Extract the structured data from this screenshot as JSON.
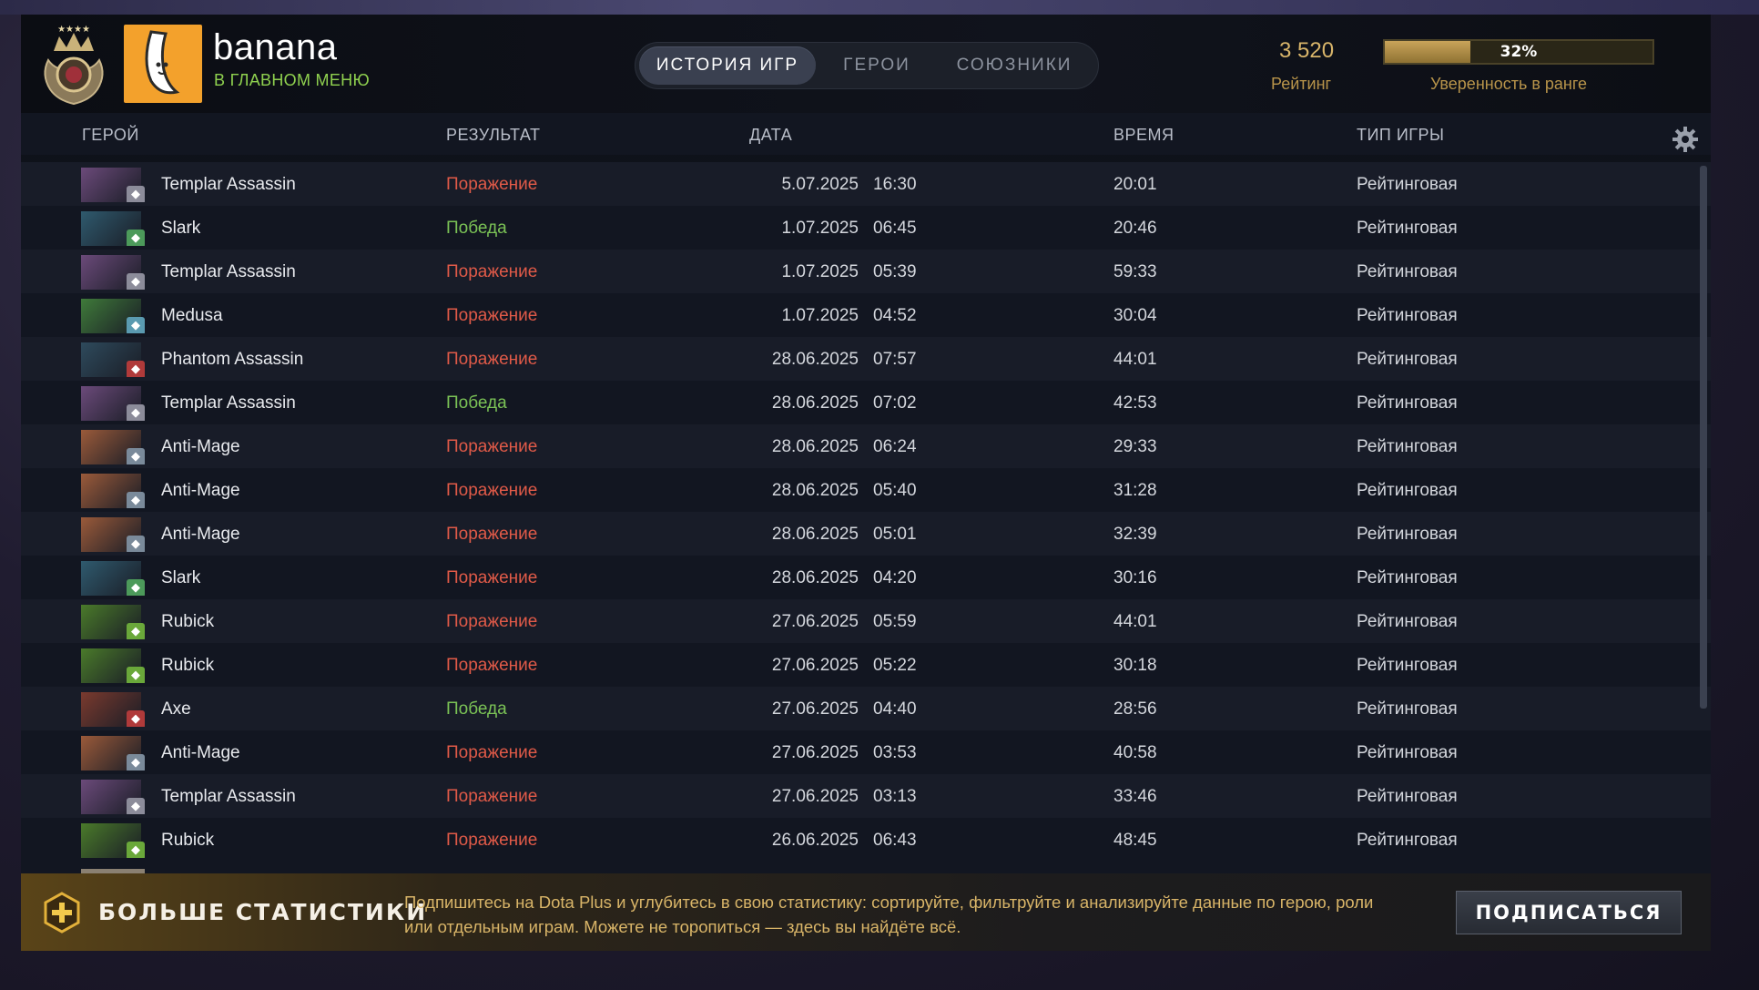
{
  "profile": {
    "name": "banana",
    "status": "В ГЛАВНОМ МЕНЮ",
    "rank_medal_icon": "rank-medal-icon",
    "avatar_icon": "banana-avatar-icon"
  },
  "tabs": [
    {
      "label": "ИСТОРИЯ ИГР",
      "active": true
    },
    {
      "label": "ГЕРОИ",
      "active": false
    },
    {
      "label": "СОЮЗНИКИ",
      "active": false
    }
  ],
  "rating": {
    "value": "3 520",
    "label": "Рейтинг"
  },
  "confidence": {
    "percent_text": "32%",
    "fraction": 0.32,
    "label": "Уверенность в ранге"
  },
  "columns": {
    "hero": "ГЕРОЙ",
    "result": "РЕЗУЛЬТАТ",
    "date": "ДАТА",
    "duration": "ВРЕМЯ",
    "game_type": "ТИП ИГРЫ"
  },
  "matches": [
    {
      "hero": "Templar Assassin",
      "result": "Поражение",
      "win": false,
      "date": "5.07.2025",
      "time": "16:30",
      "duration": "20:01",
      "type": "Рейтинговая",
      "portrait": "#6b4a7a",
      "badge": "#8c8c9a"
    },
    {
      "hero": "Slark",
      "result": "Победа",
      "win": true,
      "date": "1.07.2025",
      "time": "06:45",
      "duration": "20:46",
      "type": "Рейтинговая",
      "portrait": "#2f5a6e",
      "badge": "#4c9a5a"
    },
    {
      "hero": "Templar Assassin",
      "result": "Поражение",
      "win": false,
      "date": "1.07.2025",
      "time": "05:39",
      "duration": "59:33",
      "type": "Рейтинговая",
      "portrait": "#6b4a7a",
      "badge": "#8c8c9a"
    },
    {
      "hero": "Medusa",
      "result": "Поражение",
      "win": false,
      "date": "1.07.2025",
      "time": "04:52",
      "duration": "30:04",
      "type": "Рейтинговая",
      "portrait": "#3f7a3a",
      "badge": "#5a9ab0"
    },
    {
      "hero": "Phantom Assassin",
      "result": "Поражение",
      "win": false,
      "date": "28.06.2025",
      "time": "07:57",
      "duration": "44:01",
      "type": "Рейтинговая",
      "portrait": "#2e4a5c",
      "badge": "#b03a3a"
    },
    {
      "hero": "Templar Assassin",
      "result": "Победа",
      "win": true,
      "date": "28.06.2025",
      "time": "07:02",
      "duration": "42:53",
      "type": "Рейтинговая",
      "portrait": "#6b4a7a",
      "badge": "#8c8c9a"
    },
    {
      "hero": "Anti-Mage",
      "result": "Поражение",
      "win": false,
      "date": "28.06.2025",
      "time": "06:24",
      "duration": "29:33",
      "type": "Рейтинговая",
      "portrait": "#9a5a3a",
      "badge": "#7a8a9a"
    },
    {
      "hero": "Anti-Mage",
      "result": "Поражение",
      "win": false,
      "date": "28.06.2025",
      "time": "05:40",
      "duration": "31:28",
      "type": "Рейтинговая",
      "portrait": "#9a5a3a",
      "badge": "#7a8a9a"
    },
    {
      "hero": "Anti-Mage",
      "result": "Поражение",
      "win": false,
      "date": "28.06.2025",
      "time": "05:01",
      "duration": "32:39",
      "type": "Рейтинговая",
      "portrait": "#9a5a3a",
      "badge": "#7a8a9a"
    },
    {
      "hero": "Slark",
      "result": "Поражение",
      "win": false,
      "date": "28.06.2025",
      "time": "04:20",
      "duration": "30:16",
      "type": "Рейтинговая",
      "portrait": "#2f5a6e",
      "badge": "#4c9a5a"
    },
    {
      "hero": "Rubick",
      "result": "Поражение",
      "win": false,
      "date": "27.06.2025",
      "time": "05:59",
      "duration": "44:01",
      "type": "Рейтинговая",
      "portrait": "#4a7a2a",
      "badge": "#6aa83a"
    },
    {
      "hero": "Rubick",
      "result": "Поражение",
      "win": false,
      "date": "27.06.2025",
      "time": "05:22",
      "duration": "30:18",
      "type": "Рейтинговая",
      "portrait": "#4a7a2a",
      "badge": "#6aa83a"
    },
    {
      "hero": "Axe",
      "result": "Победа",
      "win": true,
      "date": "27.06.2025",
      "time": "04:40",
      "duration": "28:56",
      "type": "Рейтинговая",
      "portrait": "#7a3a2e",
      "badge": "#b03a3a"
    },
    {
      "hero": "Anti-Mage",
      "result": "Поражение",
      "win": false,
      "date": "27.06.2025",
      "time": "03:53",
      "duration": "40:58",
      "type": "Рейтинговая",
      "portrait": "#9a5a3a",
      "badge": "#7a8a9a"
    },
    {
      "hero": "Templar Assassin",
      "result": "Поражение",
      "win": false,
      "date": "27.06.2025",
      "time": "03:13",
      "duration": "33:46",
      "type": "Рейтинговая",
      "portrait": "#6b4a7a",
      "badge": "#8c8c9a"
    },
    {
      "hero": "Rubick",
      "result": "Поражение",
      "win": false,
      "date": "26.06.2025",
      "time": "06:43",
      "duration": "48:45",
      "type": "Рейтинговая",
      "portrait": "#4a7a2a",
      "badge": "#6aa83a"
    }
  ],
  "promo": {
    "title": "БОЛЬШЕ СТАТИСТИКИ",
    "text": "Подпишитесь на Dota Plus и углубитесь в свою статистику: сортируйте, фильтруйте и анализируйте данные по герою, роли или отдельным играм. Можете не торопиться — здесь вы найдёте всё.",
    "button": "ПОДПИСАТЬСЯ",
    "icon": "dota-plus-icon"
  },
  "colors": {
    "win": "#7bc356",
    "loss": "#e05a48",
    "gold": "#d8b56a",
    "status_green": "#8fd14f"
  }
}
